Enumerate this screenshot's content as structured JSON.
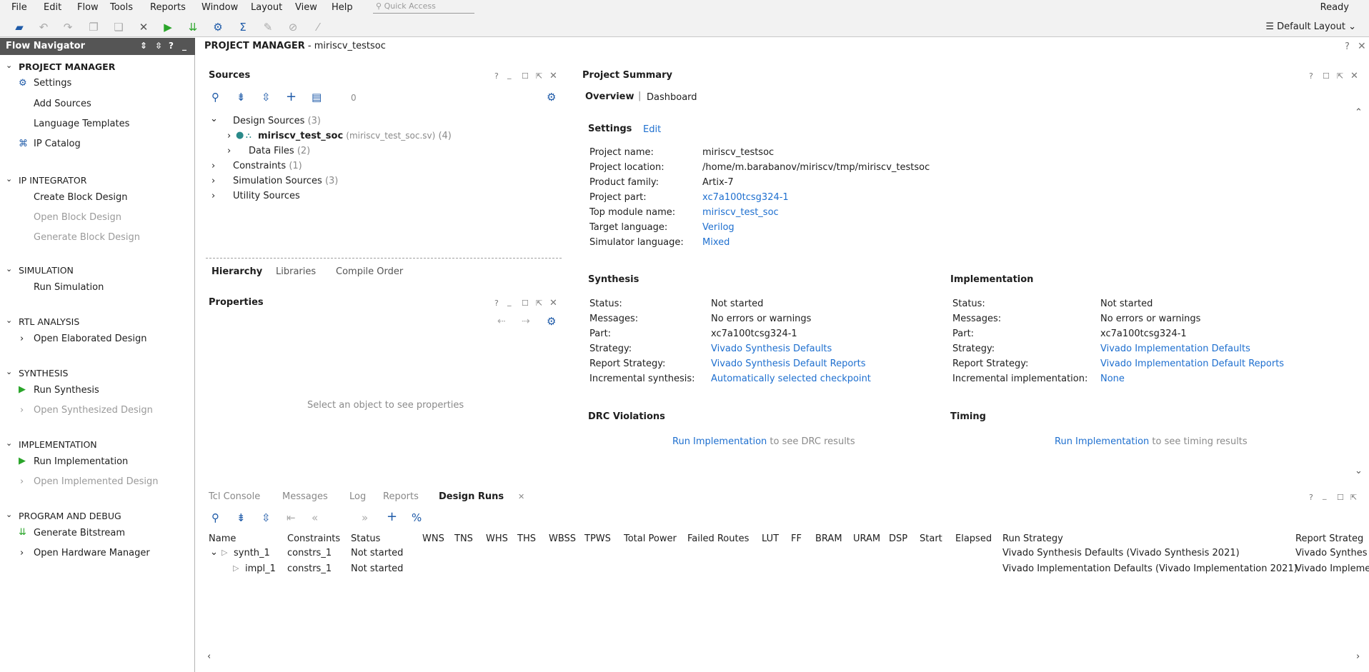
{
  "menu": {
    "items": [
      "File",
      "Edit",
      "Flow",
      "Tools",
      "Reports",
      "Window",
      "Layout",
      "View",
      "Help"
    ],
    "quick_access_placeholder": "Quick Access",
    "status": "Ready"
  },
  "toolbar": {
    "layout_label": "Default Layout"
  },
  "nav": {
    "title": "Flow Navigator",
    "sections": [
      {
        "label": "PROJECT MANAGER",
        "items": [
          "Settings",
          "Add Sources",
          "Language Templates",
          "IP Catalog"
        ]
      },
      {
        "label": "IP INTEGRATOR",
        "items": [
          "Create Block Design",
          "Open Block Design",
          "Generate Block Design"
        ]
      },
      {
        "label": "SIMULATION",
        "items": [
          "Run Simulation"
        ]
      },
      {
        "label": "RTL ANALYSIS",
        "items": [
          "Open Elaborated Design"
        ]
      },
      {
        "label": "SYNTHESIS",
        "items": [
          "Run Synthesis",
          "Open Synthesized Design"
        ]
      },
      {
        "label": "IMPLEMENTATION",
        "items": [
          "Run Implementation",
          "Open Implemented Design"
        ]
      },
      {
        "label": "PROGRAM AND DEBUG",
        "items": [
          "Generate Bitstream",
          "Open Hardware Manager"
        ]
      }
    ]
  },
  "pm": {
    "title": "PROJECT MANAGER",
    "project": " - miriscv_testsoc"
  },
  "sources": {
    "title": "Sources",
    "count": "0",
    "tree": {
      "design_sources": "Design Sources",
      "design_sources_count": "(3)",
      "top": "miriscv_test_soc",
      "top_file": "(miriscv_test_soc.sv)",
      "top_count": "(4)",
      "data_files": "Data Files",
      "data_files_count": "(2)",
      "constraints": "Constraints",
      "constraints_count": "(1)",
      "sim_sources": "Simulation Sources",
      "sim_sources_count": "(3)",
      "utility": "Utility Sources"
    },
    "tabs": [
      "Hierarchy",
      "Libraries",
      "Compile Order"
    ]
  },
  "properties": {
    "title": "Properties",
    "empty": "Select an object to see properties"
  },
  "summary": {
    "title": "Project Summary",
    "tabs": [
      "Overview",
      "Dashboard"
    ],
    "settings": {
      "title": "Settings",
      "edit": "Edit",
      "rows": [
        {
          "k": "Project name:",
          "v": "miriscv_testsoc",
          "link": false
        },
        {
          "k": "Project location:",
          "v": "/home/m.barabanov/miriscv/tmp/miriscv_testsoc",
          "link": false
        },
        {
          "k": "Product family:",
          "v": "Artix-7",
          "link": false
        },
        {
          "k": "Project part:",
          "v": "xc7a100tcsg324-1",
          "link": true
        },
        {
          "k": "Top module name:",
          "v": "miriscv_test_soc",
          "link": true
        },
        {
          "k": "Target language:",
          "v": "Verilog",
          "link": true
        },
        {
          "k": "Simulator language:",
          "v": "Mixed",
          "link": true
        }
      ]
    },
    "synthesis": {
      "title": "Synthesis",
      "rows": [
        {
          "k": "Status:",
          "v": "Not started",
          "link": false
        },
        {
          "k": "Messages:",
          "v": "No errors or warnings",
          "link": false
        },
        {
          "k": "Part:",
          "v": "xc7a100tcsg324-1",
          "link": false
        },
        {
          "k": "Strategy:",
          "v": "Vivado Synthesis Defaults",
          "link": true
        },
        {
          "k": "Report Strategy:",
          "v": "Vivado Synthesis Default Reports",
          "link": true
        },
        {
          "k": "Incremental synthesis:",
          "v": "Automatically selected checkpoint",
          "link": true
        }
      ]
    },
    "implementation": {
      "title": "Implementation",
      "rows": [
        {
          "k": "Status:",
          "v": "Not started",
          "link": false
        },
        {
          "k": "Messages:",
          "v": "No errors or warnings",
          "link": false
        },
        {
          "k": "Part:",
          "v": "xc7a100tcsg324-1",
          "link": false
        },
        {
          "k": "Strategy:",
          "v": "Vivado Implementation Defaults",
          "link": true
        },
        {
          "k": "Report Strategy:",
          "v": "Vivado Implementation Default Reports",
          "link": true
        },
        {
          "k": "Incremental implementation:",
          "v": "None",
          "link": true
        }
      ]
    },
    "drc": {
      "title": "DRC Violations",
      "link": "Run Implementation",
      "text": " to see DRC results"
    },
    "timing": {
      "title": "Timing",
      "link": "Run Implementation",
      "text": " to see timing results"
    }
  },
  "bottom": {
    "tabs": [
      "Tcl Console",
      "Messages",
      "Log",
      "Reports",
      "Design Runs"
    ],
    "columns": [
      "Name",
      "Constraints",
      "Status",
      "WNS",
      "TNS",
      "WHS",
      "THS",
      "WBSS",
      "TPWS",
      "Total Power",
      "Failed Routes",
      "LUT",
      "FF",
      "BRAM",
      "URAM",
      "DSP",
      "Start",
      "Elapsed",
      "Run Strategy",
      "Report Strateg"
    ],
    "runs": [
      {
        "name": "synth_1",
        "constraints": "constrs_1",
        "status": "Not started",
        "strategy": "Vivado Synthesis Defaults (Vivado Synthesis 2021)",
        "report": "Vivado Synthes"
      },
      {
        "name": "impl_1",
        "constraints": "constrs_1",
        "status": "Not started",
        "strategy": "Vivado Implementation Defaults (Vivado Implementation 2021)",
        "report": "Vivado Impleme"
      }
    ]
  },
  "colors": {
    "nav_header": "#555555",
    "link": "#1e6fcf",
    "run_green": "#2aa52a"
  }
}
